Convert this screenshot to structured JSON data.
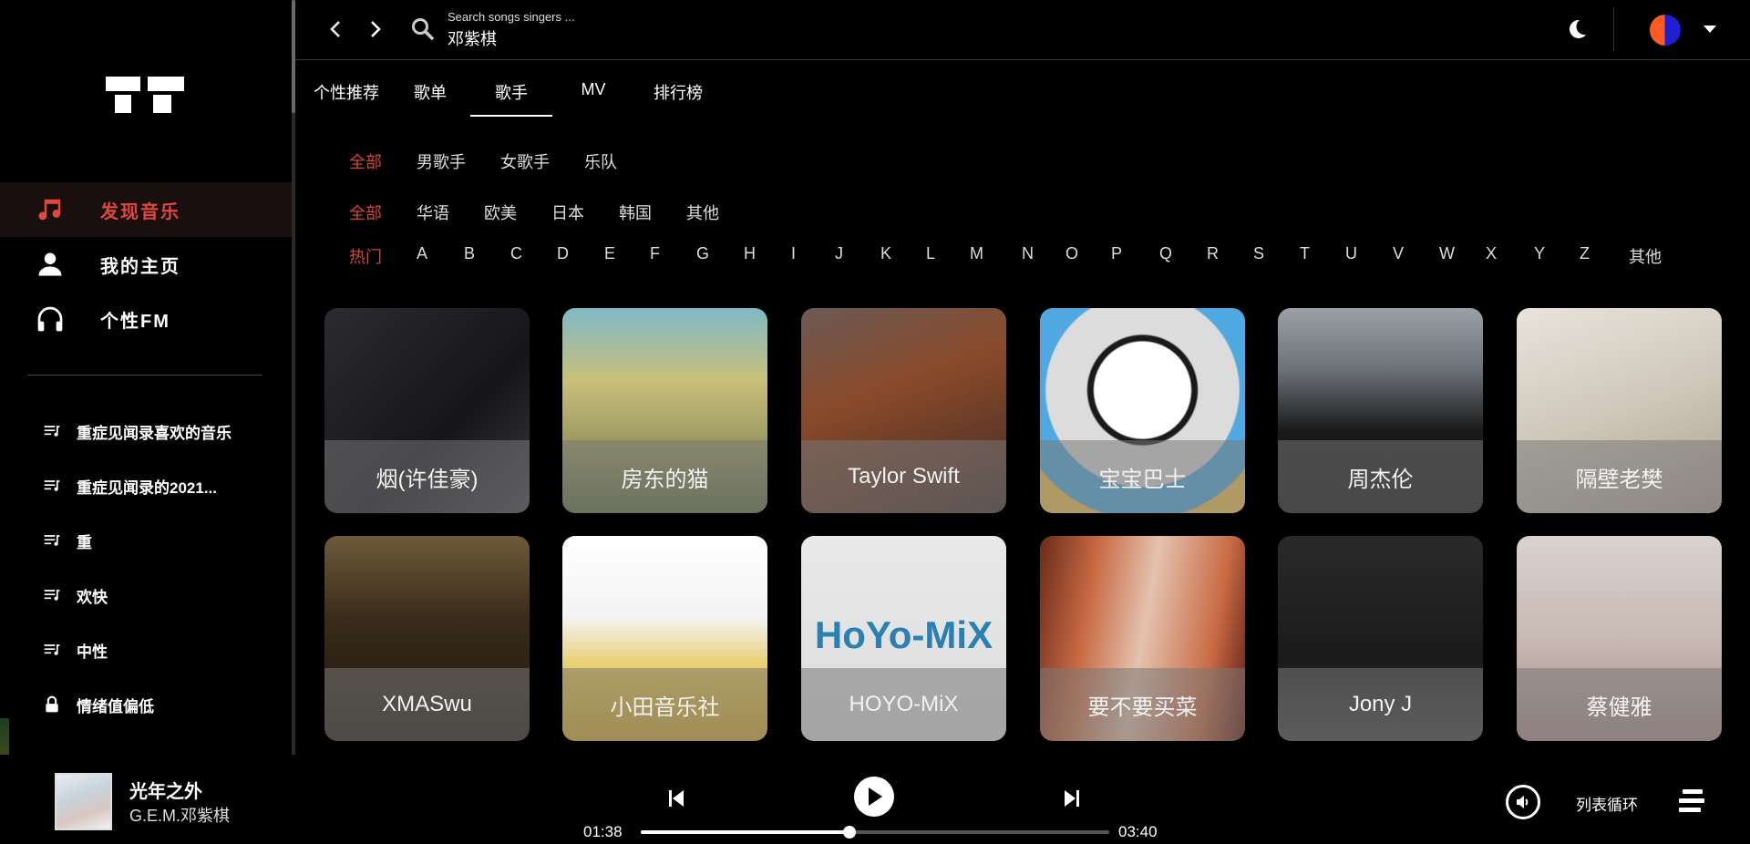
{
  "header": {
    "back_icon": "chevron-left-icon",
    "forward_icon": "chevron-right-icon",
    "search_placeholder": "Search songs singers ...",
    "search_value": "邓紫棋"
  },
  "sidebar": {
    "nav": [
      {
        "label": "发现音乐",
        "icon": "music-note-icon",
        "active": true
      },
      {
        "label": "我的主页",
        "icon": "user-icon",
        "active": false
      },
      {
        "label": "个性FM",
        "icon": "headphones-icon",
        "active": false
      }
    ],
    "playlists": [
      {
        "label": "重症见闻录喜欢的音乐",
        "icon": "playlist-icon"
      },
      {
        "label": "重症见闻录的2021...",
        "icon": "playlist-icon"
      },
      {
        "label": "重",
        "icon": "playlist-icon"
      },
      {
        "label": "欢快",
        "icon": "playlist-icon"
      },
      {
        "label": "中性",
        "icon": "playlist-icon"
      },
      {
        "label": "情绪值偏低",
        "icon": "lock-icon"
      }
    ]
  },
  "tabs": [
    {
      "label": "个性推荐",
      "active": false
    },
    {
      "label": "歌单",
      "active": false
    },
    {
      "label": "歌手",
      "active": true
    },
    {
      "label": "MV",
      "active": false
    },
    {
      "label": "排行榜",
      "active": false
    }
  ],
  "filters": {
    "type": [
      "全部",
      "男歌手",
      "女歌手",
      "乐队"
    ],
    "region": [
      "全部",
      "华语",
      "欧美",
      "日本",
      "韩国",
      "其他"
    ],
    "letters": [
      "热门",
      "A",
      "B",
      "C",
      "D",
      "E",
      "F",
      "G",
      "H",
      "I",
      "J",
      "K",
      "L",
      "M",
      "N",
      "O",
      "P",
      "Q",
      "R",
      "S",
      "T",
      "U",
      "V",
      "W",
      "X",
      "Y",
      "Z",
      "其他"
    ],
    "active_color": "#d9453b"
  },
  "artists": [
    {
      "name": "烟(许佳豪)",
      "bg": "linear-gradient(135deg,#2b2b30,#15151a 60%,#3a3a40)"
    },
    {
      "name": "房东的猫",
      "bg": "linear-gradient(180deg,#7fb9c6 0%,#c9c07a 35%,#9c9a62 65%,#5b6a40 100%)"
    },
    {
      "name": "Taylor Swift",
      "bg": "linear-gradient(160deg,#6b5a55,#8a4a2a 40%,#3d2a25 100%)"
    },
    {
      "name": "宝宝巴士",
      "bg": "radial-gradient(circle at 50% 40%,#ffffff 0 30%,#1a1a1a 31% 34%,#dcdcdc 35% 60%,#4fa8e0 61% 80%,#f2c14e 81%)"
    },
    {
      "name": "周杰伦",
      "bg": "linear-gradient(180deg,#9aa0a6 0%,#6c7278 30%,#1a1a1a 60%,#0d0d0d 100%)"
    },
    {
      "name": "隔壁老樊",
      "bg": "linear-gradient(160deg,#e8e4dc,#cfc7ba 50%,#a99f90 100%)"
    },
    {
      "name": "XMASwu",
      "bg": "linear-gradient(180deg,#6e5a3a 0%,#3a2c1a 40%,#1a140c 100%)"
    },
    {
      "name": "小田音乐社",
      "bg": "linear-gradient(180deg,#ffffff 0%,#f3f3f3 40%,#e6c44a 70%,#d2a62c 100%)"
    },
    {
      "name": "HOYO-MiX",
      "bg": "linear-gradient(180deg,#e9e9e9,#dcdcdc)",
      "logo": "HoYo-MiX"
    },
    {
      "name": "要不要买菜",
      "bg": "linear-gradient(100deg,#6a2a1a 0%,#c86a44 25%,#e4c2ae 50%,#c86a44 80%,#5a1a10 100%)"
    },
    {
      "name": "Jony J",
      "bg": "linear-gradient(180deg,#2a2a2a,#1a1a1a 60%,#3a3a3a)"
    },
    {
      "name": "蔡健雅",
      "bg": "linear-gradient(180deg,#d9d2cf,#c8b9b3 50%,#a98b86 100%)"
    }
  ],
  "player": {
    "title": "光年之外",
    "artist": "G.E.M.邓紫棋",
    "current_time": "01:38",
    "total_time": "03:40",
    "progress": 0.445,
    "loop_mode": "列表循环",
    "prev_icon": "skip-previous-icon",
    "play_icon": "play-icon",
    "next_icon": "skip-next-icon",
    "sound_icon": "speaker-icon",
    "queue_icon": "queue-list-icon"
  }
}
